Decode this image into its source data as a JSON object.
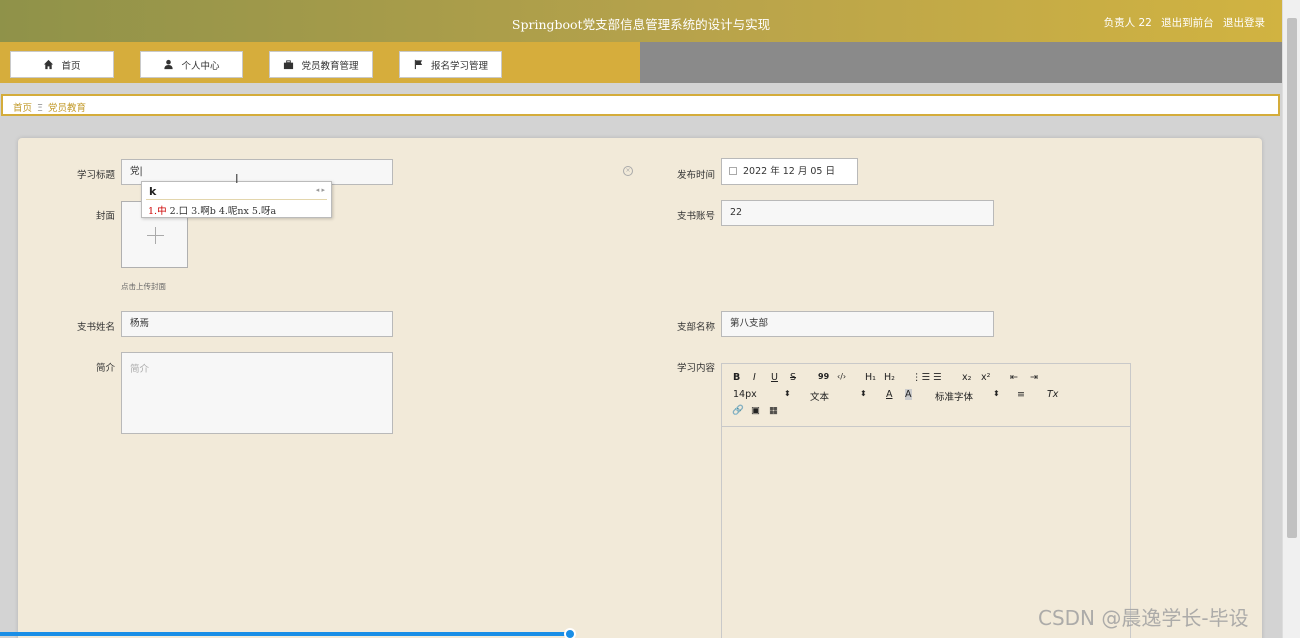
{
  "header": {
    "title": "Springboot党支部信息管理系统的设计与实现",
    "user_label": "负责人 22",
    "back_label": "退出到前台",
    "logout_label": "退出登录"
  },
  "nav": {
    "items": [
      {
        "label": "首页",
        "icon": "home-icon"
      },
      {
        "label": "个人中心",
        "icon": "user-icon"
      },
      {
        "label": "党员教育管理",
        "icon": "briefcase-icon"
      },
      {
        "label": "报名学习管理",
        "icon": "flag-icon"
      }
    ]
  },
  "breadcrumb": {
    "home": "首页",
    "separator": "Ξ",
    "current": "党员教育"
  },
  "form": {
    "title_label": "学习标题",
    "title_value": "党|",
    "cover_label": "封面",
    "cover_hint": "点击上传封面",
    "secretary_name_label": "支书姓名",
    "secretary_name_value": "杨焉",
    "intro_label": "简介",
    "intro_placeholder": "简介",
    "publish_time_label": "发布时间",
    "publish_time_value": "2022 年 12 月 05 日",
    "account_label": "支书账号",
    "account_value": "22",
    "branch_label": "支部名称",
    "branch_value": "第八支部",
    "content_label": "学习内容"
  },
  "ime": {
    "input": "k",
    "arrows": "◂ ▸",
    "candidate1": "1.中",
    "candidates_rest": " 2.口 3.啊b 4.呢nx 5.呀a"
  },
  "editor": {
    "bold": "B",
    "italic": "I",
    "underline": "U",
    "strike": "S",
    "quote": "99",
    "code": "‹/›",
    "h1": "H₁",
    "h2": "H₂",
    "ol": "⋮☰",
    "ul": "☰",
    "sub": "x₂",
    "sup": "x²",
    "outdent": "⇤",
    "indent": "⇥",
    "size_value": "14px",
    "format_value": "文本",
    "font_color": "A",
    "bg_color": "A",
    "font_family_value": "标准字体",
    "align": "≡",
    "clear_format": "Tx",
    "link": "🔗",
    "image": "▣",
    "video": "▦"
  },
  "watermark": "CSDN @晨逸学长-毕设",
  "colors": {
    "header_start": "#8f9249",
    "header_end": "#d1b341",
    "nav_accent": "#d6ad3c",
    "card_bg": "#f2ead9",
    "progress": "#1a8ee6"
  }
}
